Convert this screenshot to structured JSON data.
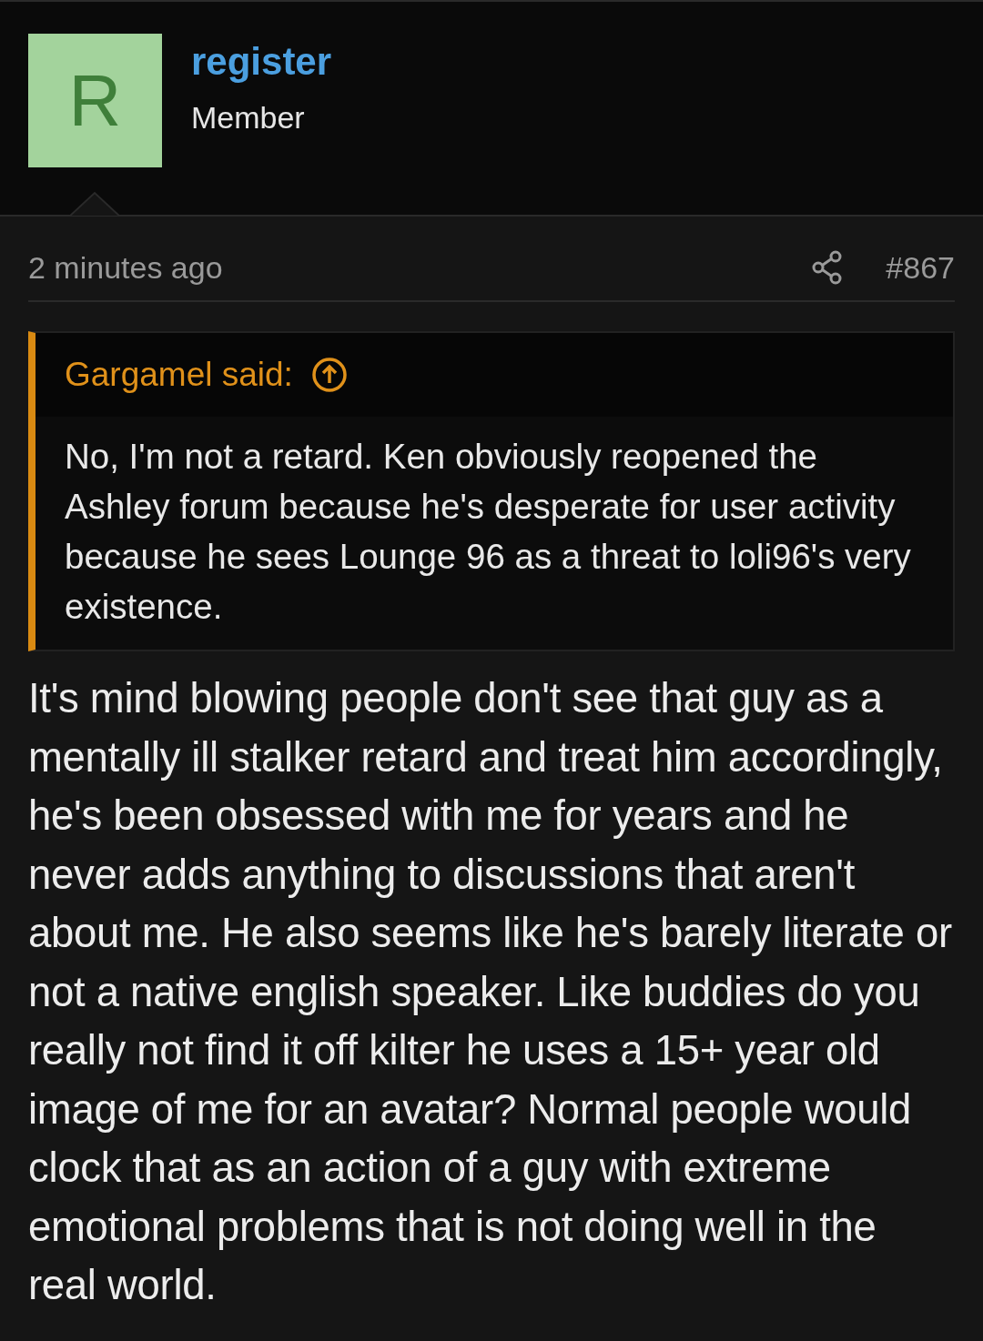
{
  "author": {
    "avatar_letter": "R",
    "name": "register",
    "role": "Member"
  },
  "post": {
    "time": "2 minutes ago",
    "number": "#867",
    "quote": {
      "author": "Gargamel said:",
      "text": "No, I'm not a retard. Ken obviously reopened the Ashley forum because he's desperate for user activity because he sees Lounge 96 as a threat to loli96's very existence."
    },
    "body": "It's mind blowing people don't see that guy as a mentally ill stalker retard and treat him accordingly, he's been obsessed with me for years and he never adds anything to discussions that aren't about me. He also seems like he's barely literate or not a native english speaker. Like buddies do you really not find it off kilter he uses a 15+ year old image of me for an avatar? Normal people would clock that as an action of a guy with extreme emotional problems that is not doing well in the real world."
  }
}
